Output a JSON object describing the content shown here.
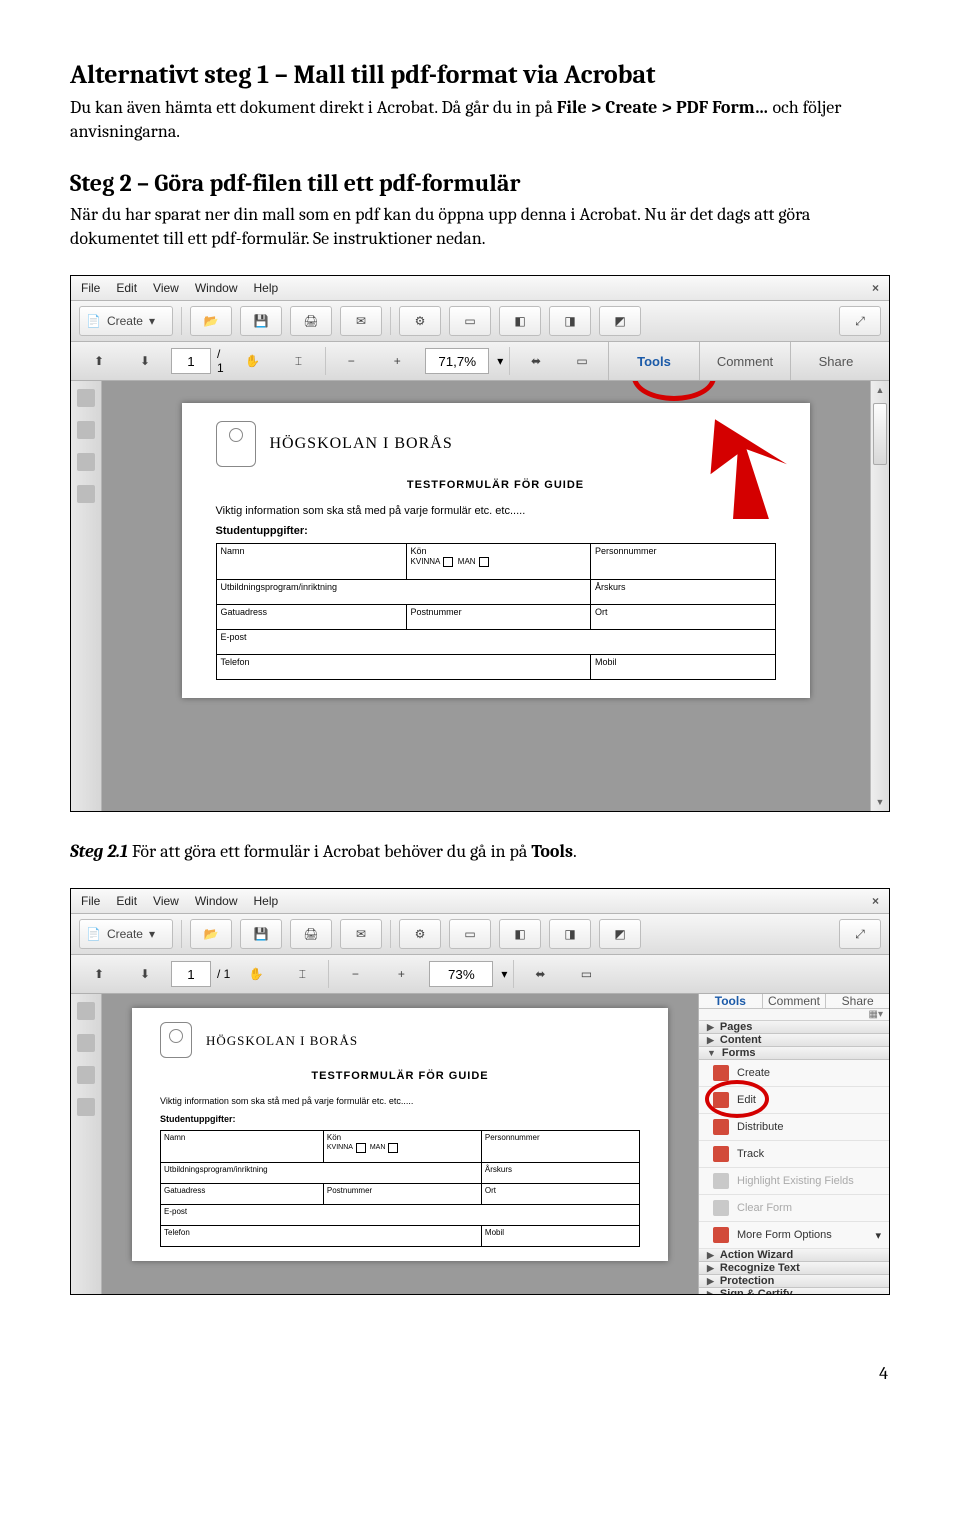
{
  "doc": {
    "h1": "Alternativt steg 1 – Mall till pdf-format via Acrobat",
    "p1a": "Du kan även hämta ett dokument direkt i Acrobat. Då går du in på ",
    "p1b": "File > Create > PDF Form… ",
    "p1c": "och följer anvisningarna.",
    "h2": "Steg 2 – Göra pdf-filen till ett pdf-formulär",
    "p2": "När du har sparat ner din mall som en pdf kan du öppna upp denna i Acrobat. Nu är det dags att göra dokumentet till ett pdf-formulär. Se instruktioner nedan.",
    "step21a": "Steg 2.1",
    "step21b": " För att göra ett formulär i Acrobat behöver du gå in på ",
    "step21c": "Tools",
    "step21d": ".",
    "pageNum": "4"
  },
  "acro": {
    "menu": {
      "file": "File",
      "edit": "Edit",
      "view": "View",
      "window": "Window",
      "help": "Help",
      "close": "×"
    },
    "create": "Create",
    "page": "1",
    "pageOf": "/ 1",
    "zoom1": "71,7%",
    "zoom2": "73%",
    "tabs": {
      "tools": "Tools",
      "comment": "Comment",
      "share": "Share"
    }
  },
  "paper": {
    "uni": "HÖGSKOLAN I BORÅS",
    "title": "TESTFORMULÄR FÖR GUIDE",
    "info": "Viktig information som ska stå med på varje formulär etc. etc.....",
    "stud": "Studentuppgifter:",
    "c": {
      "namn": "Namn",
      "kon": "Kön",
      "kvinna": "KVINNA",
      "man": "MAN",
      "pnr": "Personnummer",
      "utb": "Utbildningsprogram/inriktning",
      "arskurs": "Årskurs",
      "gatu": "Gatuadress",
      "postnr": "Postnummer",
      "ort": "Ort",
      "epost": "E-post",
      "telefon": "Telefon",
      "mobil": "Mobil"
    }
  },
  "panel": {
    "pages": "Pages",
    "content": "Content",
    "forms": "Forms",
    "create": "Create",
    "edit": "Edit",
    "dist": "Distribute",
    "track": "Track",
    "hl": "Highlight Existing Fields",
    "clear": "Clear Form",
    "more": "More Form Options",
    "aw": "Action Wizard",
    "rt": "Recognize Text",
    "prot": "Protection",
    "sc": "Sign & Certify"
  }
}
